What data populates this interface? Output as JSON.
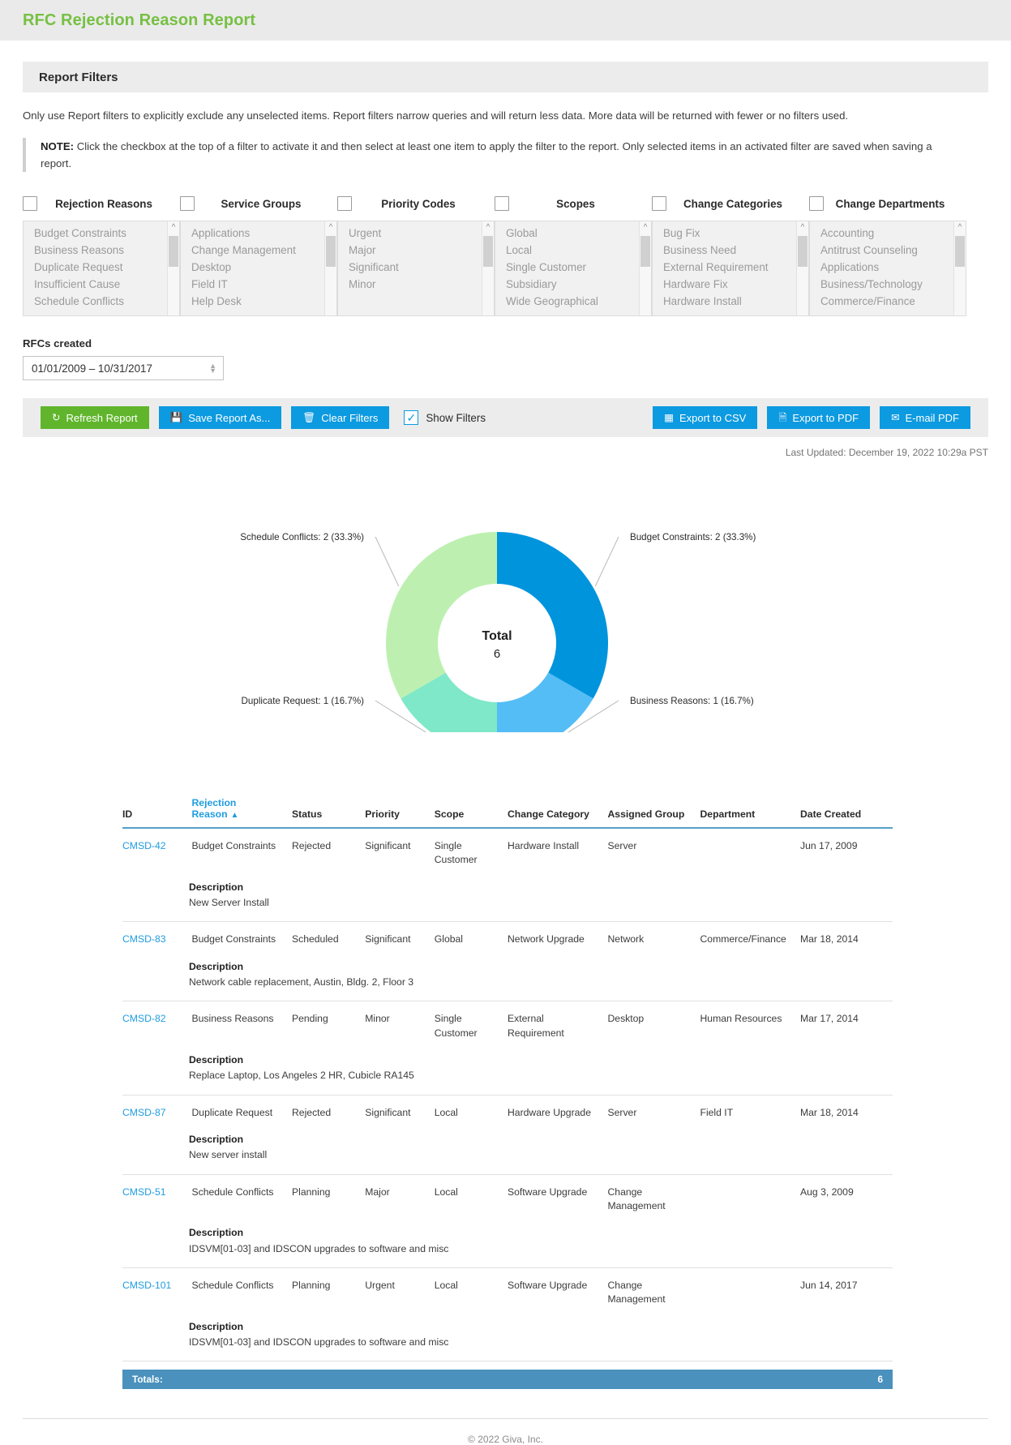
{
  "header": {
    "title": "RFC Rejection Reason Report"
  },
  "panel": {
    "heading": "Report Filters"
  },
  "intro": "Only use Report filters to explicitly exclude any unselected items. Report filters narrow queries and will return less data. More data will be returned with fewer or no filters used.",
  "note": {
    "label": "NOTE:",
    "text": " Click the checkbox at the top of a filter to activate it and then select at least one item to apply the filter to the report. Only selected items in an activated filter are saved when saving a report."
  },
  "filters": [
    {
      "title": "Rejection Reasons",
      "checked": false,
      "items": [
        "Budget Constraints",
        "Business Reasons",
        "Duplicate Request",
        "Insufficient Cause",
        "Schedule Conflicts"
      ]
    },
    {
      "title": "Service Groups",
      "checked": false,
      "items": [
        "Applications",
        "Change Management",
        "Desktop",
        "Field IT",
        "Help Desk"
      ]
    },
    {
      "title": "Priority Codes",
      "checked": false,
      "items": [
        "Urgent",
        "Major",
        "Significant",
        "Minor"
      ]
    },
    {
      "title": "Scopes",
      "checked": false,
      "items": [
        "Global",
        "Local",
        "Single Customer",
        "Subsidiary",
        "Wide Geographical"
      ]
    },
    {
      "title": "Change Categories",
      "checked": false,
      "items": [
        "Bug Fix",
        "Business Need",
        "External Requirement",
        "Hardware Fix",
        "Hardware Install"
      ]
    },
    {
      "title": "Change Departments",
      "checked": false,
      "items": [
        "Accounting",
        "Antitrust Counseling",
        "Applications",
        "Business/Technology",
        "Commerce/Finance"
      ]
    }
  ],
  "daterange": {
    "label": "RFCs created",
    "value": "01/01/2009 – 10/31/2017"
  },
  "toolbar": {
    "refresh": "Refresh Report",
    "save_as": "Save Report As...",
    "clear": "Clear Filters",
    "show_filters": "Show Filters",
    "show_filters_checked": true,
    "export_csv": "Export to CSV",
    "export_pdf": "Export to PDF",
    "email_pdf": "E-mail PDF"
  },
  "last_updated": "Last Updated: December 19, 2022 10:29a PST",
  "chart_data": {
    "type": "pie",
    "variant": "donut",
    "title": "",
    "center_label": "Total",
    "center_value": "6",
    "total": 6,
    "categories": [
      "Budget Constraints",
      "Business Reasons",
      "Duplicate Request",
      "Schedule Conflicts"
    ],
    "values": [
      2,
      1,
      1,
      2
    ],
    "percents": [
      "33.3%",
      "16.7%",
      "16.7%",
      "33.3%"
    ],
    "colors": [
      "#0094dd",
      "#54bdf5",
      "#7fe8c8",
      "#bdf0b0"
    ],
    "labels": [
      "Budget Constraints: 2 (33.3%)",
      "Business Reasons: 1 (16.7%)",
      "Duplicate Request: 1 (16.7%)",
      "Schedule Conflicts: 2 (33.3%)"
    ],
    "legend_position": "callout-labels",
    "grid": false
  },
  "table": {
    "columns": [
      "ID",
      "Rejection Reason",
      "Status",
      "Priority",
      "Scope",
      "Change Category",
      "Assigned Group",
      "Department",
      "Date Created"
    ],
    "sorted_column": "Rejection Reason",
    "sort_direction": "asc",
    "description_label": "Description",
    "rows": [
      {
        "id": "CMSD-42",
        "reason": "Budget Constraints",
        "status": "Rejected",
        "priority": "Significant",
        "scope": "Single Customer",
        "category": "Hardware Install",
        "group": "Server",
        "department": "",
        "date": "Jun 17, 2009",
        "description": "New Server Install"
      },
      {
        "id": "CMSD-83",
        "reason": "Budget Constraints",
        "status": "Scheduled",
        "priority": "Significant",
        "scope": "Global",
        "category": "Network Upgrade",
        "group": "Network",
        "department": "Commerce/Finance",
        "date": "Mar 18, 2014",
        "description": "Network cable replacement, Austin, Bldg. 2, Floor 3"
      },
      {
        "id": "CMSD-82",
        "reason": "Business Reasons",
        "status": "Pending",
        "priority": "Minor",
        "scope": "Single Customer",
        "category": "External Requirement",
        "group": "Desktop",
        "department": "Human Resources",
        "date": "Mar 17, 2014",
        "description": "Replace Laptop, Los Angeles 2 HR, Cubicle RA145"
      },
      {
        "id": "CMSD-87",
        "reason": "Duplicate Request",
        "status": "Rejected",
        "priority": "Significant",
        "scope": "Local",
        "category": "Hardware Upgrade",
        "group": "Server",
        "department": "Field IT",
        "date": "Mar 18, 2014",
        "description": "New server install"
      },
      {
        "id": "CMSD-51",
        "reason": "Schedule Conflicts",
        "status": "Planning",
        "priority": "Major",
        "scope": "Local",
        "category": "Software Upgrade",
        "group": "Change Management",
        "department": "",
        "date": "Aug 3, 2009",
        "description": "IDSVM[01-03] and IDSCON upgrades to software and misc"
      },
      {
        "id": "CMSD-101",
        "reason": "Schedule Conflicts",
        "status": "Planning",
        "priority": "Urgent",
        "scope": "Local",
        "category": "Software Upgrade",
        "group": "Change Management",
        "department": "",
        "date": "Jun 14, 2017",
        "description": "IDSVM[01-03] and IDSCON upgrades to software and misc"
      }
    ],
    "totals_label": "Totals:",
    "totals_value": "6"
  },
  "footer": {
    "copyright": "© 2022 Giva, Inc."
  }
}
